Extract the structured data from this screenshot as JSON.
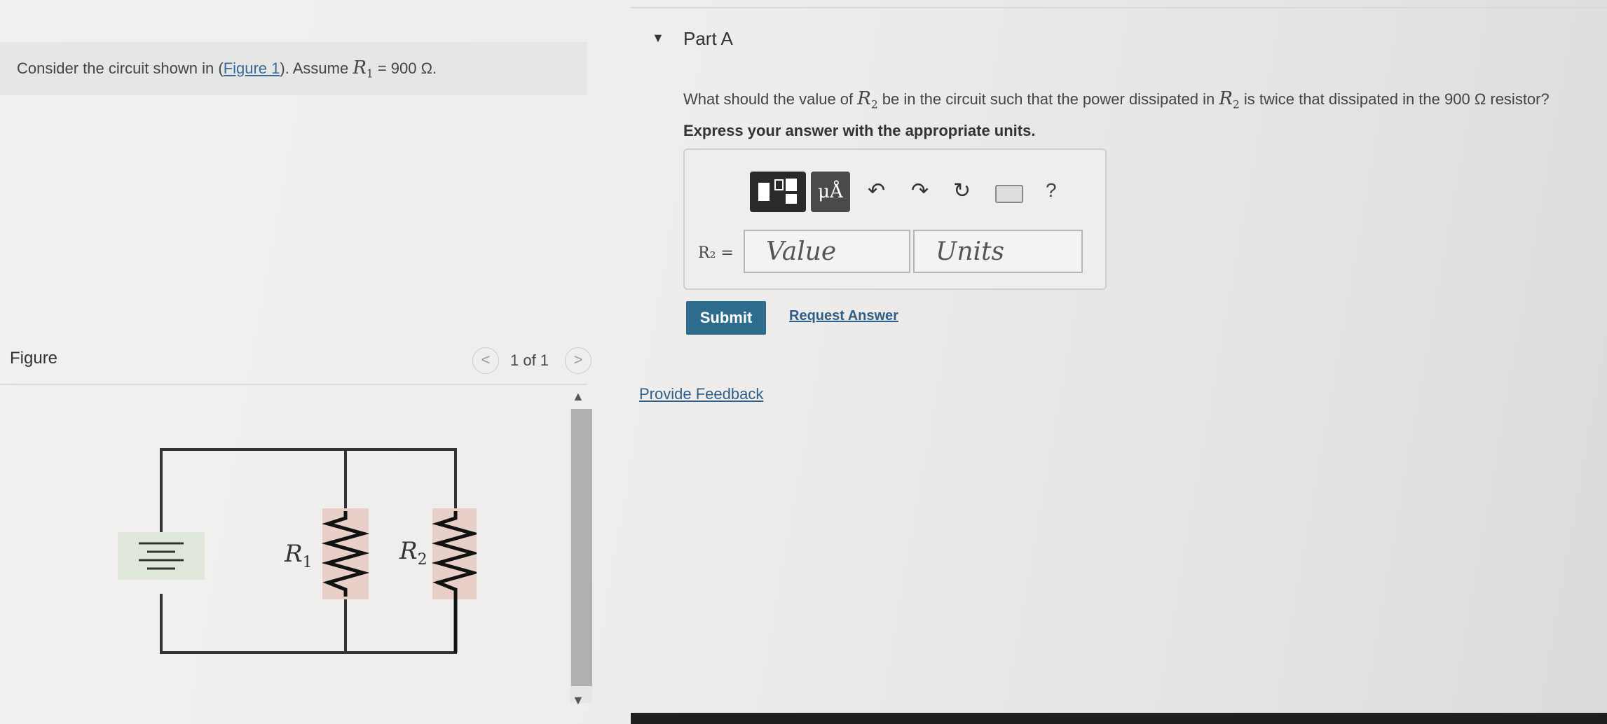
{
  "problem": {
    "prefix": "Consider the circuit shown in (",
    "figure_link": "Figure 1",
    "middle": "). Assume ",
    "r1_symbol": "R",
    "r1_sub": "1",
    "equals_value": " = 900 Ω."
  },
  "figure": {
    "label": "Figure",
    "counter": "1 of 1",
    "prev": "<",
    "next": ">",
    "circuit": {
      "r1_label": "R",
      "r1_sub": "1",
      "r2_label": "R",
      "r2_sub": "2"
    }
  },
  "part_a": {
    "title": "Part A",
    "question_1": "What should the value of ",
    "question_sym": "R",
    "question_sub": "2",
    "question_2": " be in the circuit such that the power dissipated in ",
    "question_3": " is twice that dissipated in the 900 Ω resistor?",
    "instruction": "Express your answer with the appropriate units.",
    "toolbar": {
      "units_label": "μÅ",
      "undo_icon": "undo-icon",
      "redo_icon": "redo-icon",
      "reset_icon": "reset-icon",
      "keyboard_icon": "keyboard-icon",
      "help_label": "?"
    },
    "answer_label": "R₂ =",
    "value_placeholder": "Value",
    "units_placeholder": "Units",
    "submit_label": "Submit",
    "request_answer_label": "Request Answer"
  },
  "feedback_label": "Provide Feedback",
  "colors": {
    "submit": "#2e6c8e",
    "link": "#2f5f8a",
    "resistor_bg": "#e8d0c8",
    "battery_bg": "#e0e8dc"
  }
}
